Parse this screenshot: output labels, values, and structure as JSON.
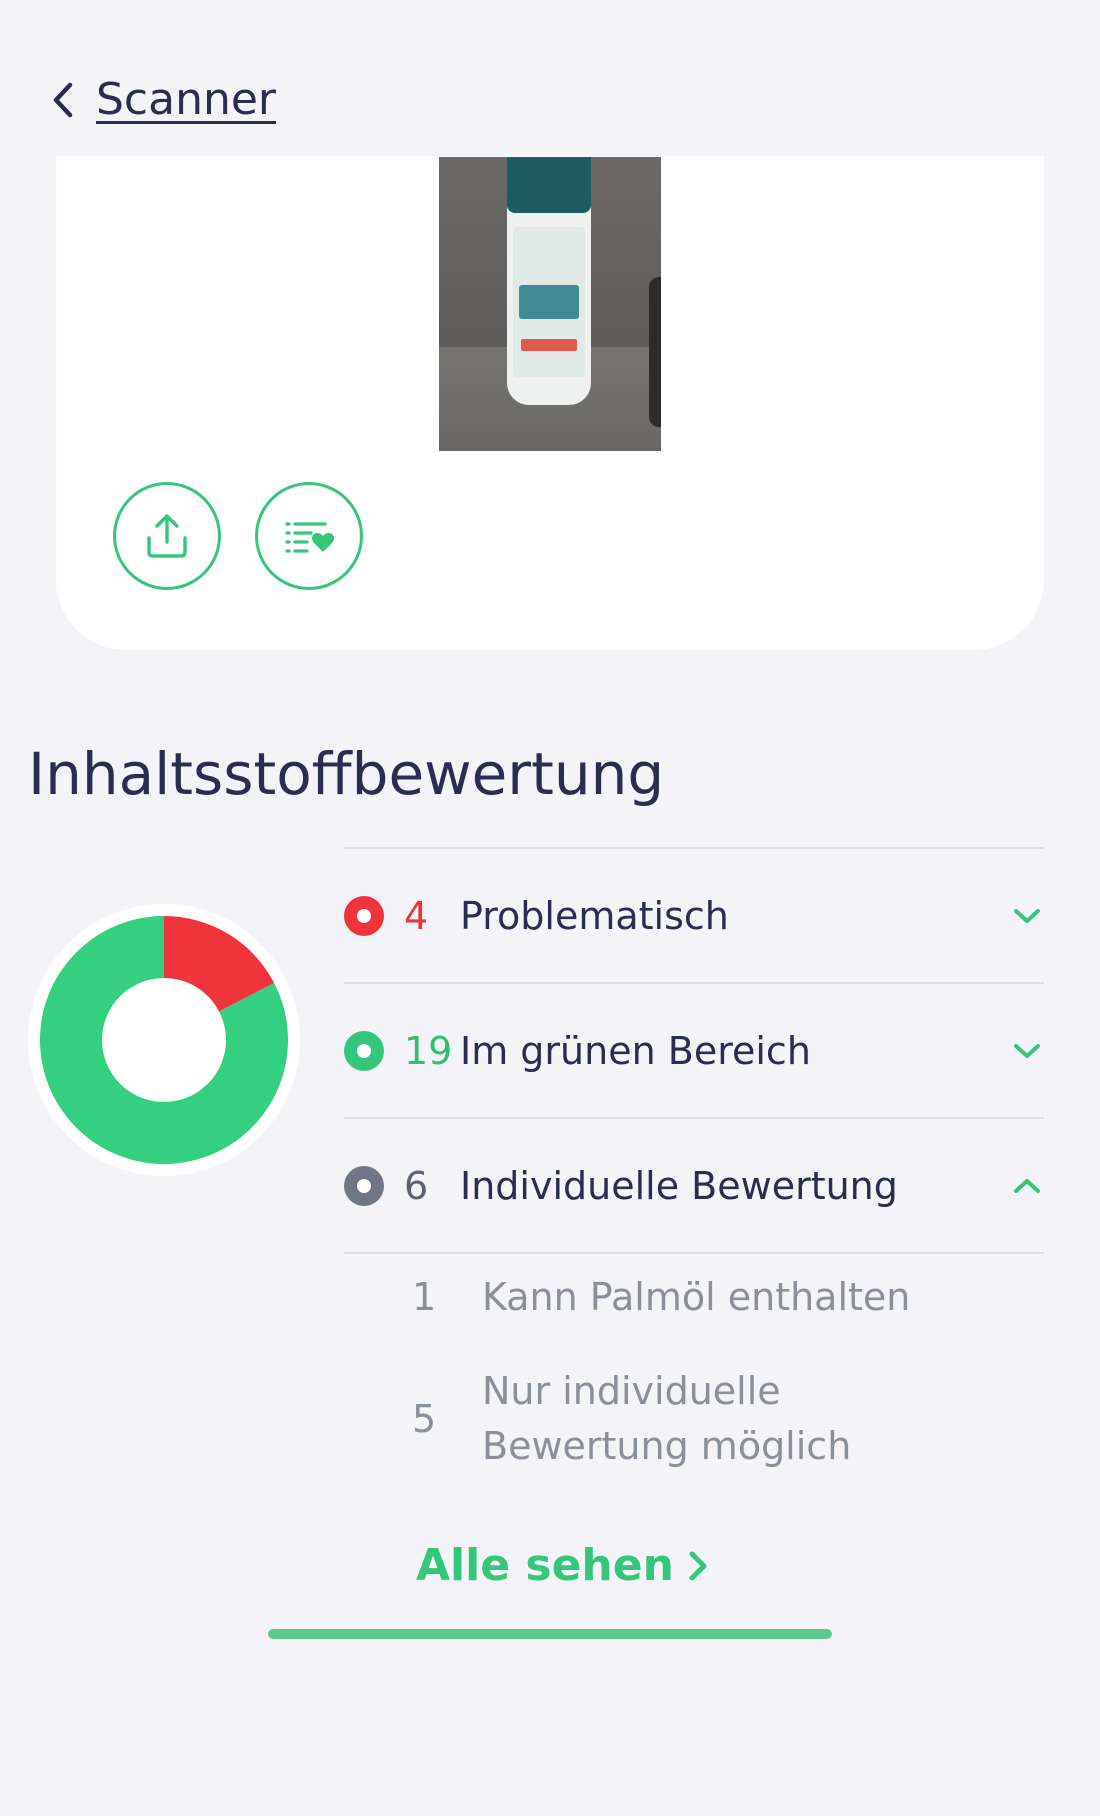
{
  "header": {
    "back_label": "Scanner",
    "back_icon": "chevron-left-icon"
  },
  "product_card": {
    "actions": [
      {
        "name": "share",
        "icon": "share-upload-icon"
      },
      {
        "name": "favorites-list",
        "icon": "list-heart-icon"
      }
    ]
  },
  "section": {
    "title": "Inhaltsstoffbewertung"
  },
  "rating_chart": {
    "type": "donut",
    "segments": [
      {
        "label": "Problematisch",
        "value": 4,
        "color": "#f0343c"
      },
      {
        "label": "Im grünen Bereich",
        "value": 19,
        "color": "#34d07f"
      }
    ]
  },
  "ratings": [
    {
      "count": "4",
      "label": "Problematisch",
      "status": "red",
      "expanded": false
    },
    {
      "count": "19",
      "label": "Im grünen Bereich",
      "status": "green",
      "expanded": false
    },
    {
      "count": "6",
      "label": "Individuelle Bewertung",
      "status": "gray",
      "expanded": true,
      "items": [
        {
          "count": "1",
          "label": "Kann Palmöl enthalten"
        },
        {
          "count": "5",
          "label": "Nur individuelle Bewertung möglich"
        }
      ]
    }
  ],
  "see_all": {
    "label": "Alle sehen"
  },
  "colors": {
    "accent": "#34c77b",
    "problem": "#f0343c",
    "neutral": "#6f7684",
    "text": "#2b2d4e"
  }
}
